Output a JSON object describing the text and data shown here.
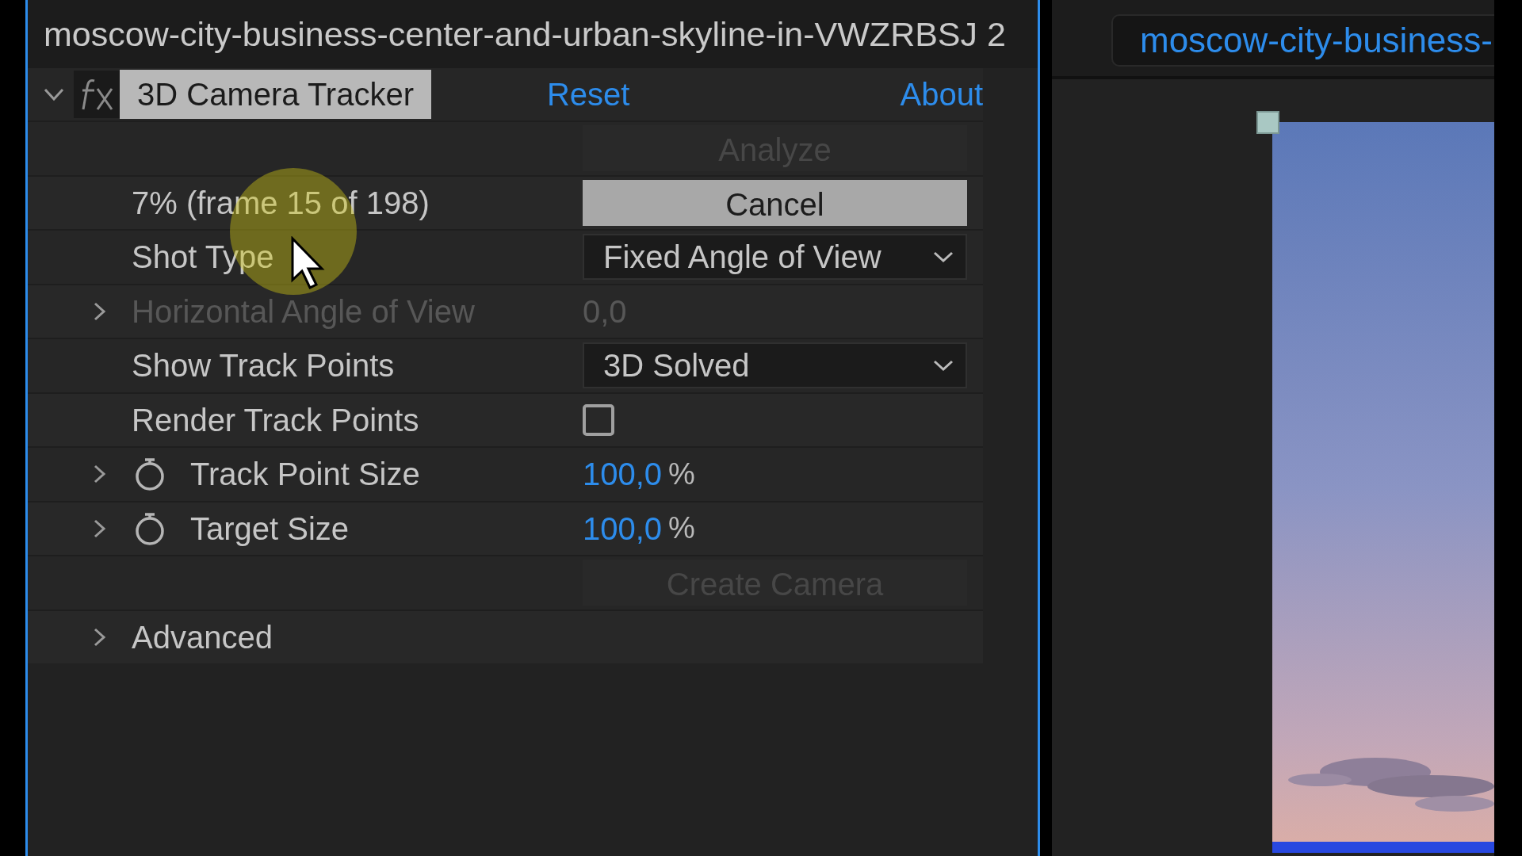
{
  "comp_panel": {
    "title": "moscow-city-business-center-and-urban-skyline-in-VWZRBSJ 2"
  },
  "effect": {
    "name": "3D Camera Tracker",
    "expanded": true,
    "reset": "Reset",
    "about": "About"
  },
  "properties": [
    {
      "kind": "button",
      "button": "Analyze",
      "disabled": true
    },
    {
      "kind": "progress",
      "label": "7% (frame 15 of 198)",
      "button": "Cancel",
      "disabled": false
    },
    {
      "kind": "dropdown",
      "label": "Shot Type",
      "value": "Fixed Angle of View",
      "disabled": false
    },
    {
      "kind": "value",
      "label": "Horizontal Angle of View",
      "value": "0,0",
      "disabled": true,
      "expanded": false
    },
    {
      "kind": "dropdown",
      "label": "Show Track Points",
      "value": "3D Solved",
      "disabled": false
    },
    {
      "kind": "checkbox",
      "label": "Render Track Points",
      "checked": false,
      "disabled": false
    },
    {
      "kind": "number",
      "label": "Track Point Size",
      "value": "100,0",
      "unit": "%",
      "disabled": false,
      "expanded": false
    },
    {
      "kind": "number",
      "label": "Target Size",
      "value": "100,0",
      "unit": "%",
      "disabled": false,
      "expanded": false
    },
    {
      "kind": "button",
      "button": "Create Camera",
      "disabled": true
    },
    {
      "kind": "group",
      "label": "Advanced",
      "disabled": false,
      "expanded": false
    }
  ],
  "viewer": {
    "tab": "moscow-city-business-"
  }
}
